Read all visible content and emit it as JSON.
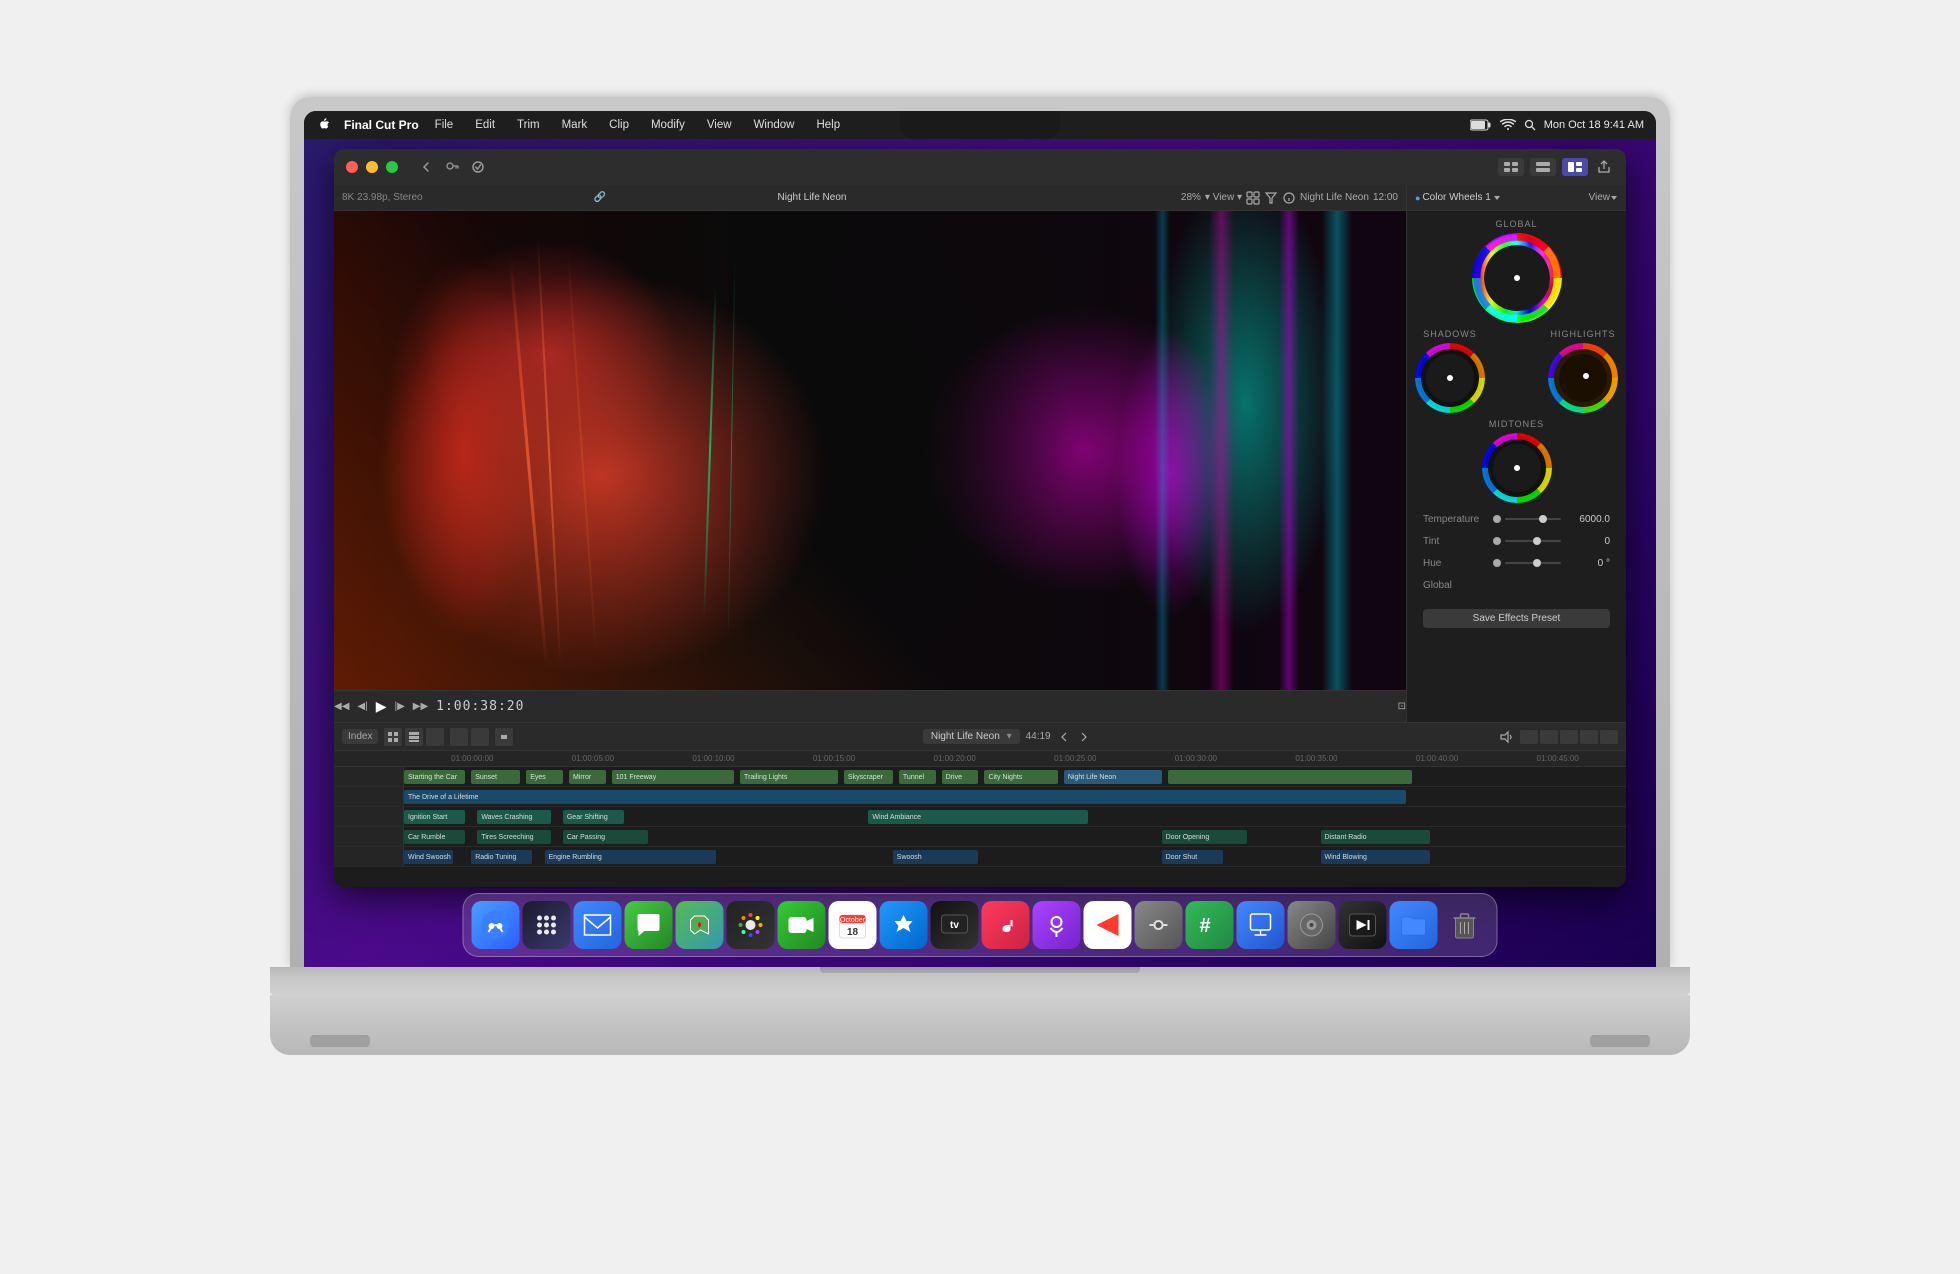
{
  "menubar": {
    "app": "Final Cut Pro",
    "items": [
      "File",
      "Edit",
      "Trim",
      "Mark",
      "Clip",
      "Modify",
      "View",
      "Window",
      "Help"
    ],
    "right": {
      "datetime": "Mon Oct 18  9:41 AM"
    }
  },
  "window": {
    "title": "Night Life Neon",
    "resolution": "8K 23.98p, Stereo",
    "zoom": "28%",
    "timecode": "1:00:38:20",
    "duration": "12:00"
  },
  "colorPanel": {
    "title": "Color Wheels 1",
    "view_btn": "View",
    "wheels": {
      "global_label": "GLOBAL",
      "shadows_label": "SHADOWS",
      "highlights_label": "HIGHLIGHTS",
      "midtones_label": "MIDTONES"
    },
    "params": [
      {
        "label": "Temperature",
        "value": "6000.0"
      },
      {
        "label": "Tint",
        "value": "0"
      },
      {
        "label": "Hue",
        "value": "0 °"
      },
      {
        "label": "Global",
        "value": ""
      }
    ],
    "save_btn": "Save Effects Preset"
  },
  "timeline": {
    "clip_name": "Night Life Neon",
    "timecode_display": "44:19",
    "ruler_marks": [
      "01:00:00:00",
      "01:00:05:00",
      "01:00:10:00",
      "01:00:15:00",
      "01:00:20:00",
      "01:00:25:00",
      "01:00:30:00",
      "01:00:35:00",
      "01:00:40:00",
      "01:00:45:00"
    ],
    "tracks": [
      {
        "clips": [
          {
            "label": "Starting the Car",
            "left": "0%",
            "width": "5%",
            "color": "#4a7a4a"
          },
          {
            "label": "Sunset",
            "left": "5.5%",
            "width": "4%",
            "color": "#4a7a4a"
          },
          {
            "label": "Eyes",
            "left": "10%",
            "width": "3%",
            "color": "#4a7a4a"
          },
          {
            "label": "Mirror",
            "left": "13.5%",
            "width": "3%",
            "color": "#4a7a4a"
          },
          {
            "label": "101 Freeway",
            "left": "17%",
            "width": "10%",
            "color": "#4a7a4a"
          },
          {
            "label": "Trailing Lights",
            "left": "27.5%",
            "width": "8%",
            "color": "#4a7a4a"
          },
          {
            "label": "Skyscraper",
            "left": "36%",
            "width": "4%",
            "color": "#4a7a4a"
          },
          {
            "label": "Tunnel",
            "left": "40.5%",
            "width": "3%",
            "color": "#4a7a4a"
          },
          {
            "label": "Drive",
            "left": "44%",
            "width": "3%",
            "color": "#4a7a4a"
          },
          {
            "label": "City Nights",
            "left": "47.5%",
            "width": "6%",
            "color": "#4a7a4a"
          },
          {
            "label": "Night Life Neon",
            "left": "54%",
            "width": "8%",
            "color": "#3a6a8a"
          },
          {
            "label": "",
            "left": "62.5%",
            "width": "20%",
            "color": "#4a7a4a"
          }
        ]
      },
      {
        "clips": [
          {
            "label": "The Drive of a Lifetime",
            "left": "0%",
            "width": "82%",
            "color": "#2a5a7a"
          }
        ]
      },
      {
        "clips": [
          {
            "label": "Ignition Start",
            "left": "0%",
            "width": "5%",
            "color": "#2a6a5a"
          },
          {
            "label": "Waves Crashing",
            "left": "6%",
            "width": "6%",
            "color": "#2a6a5a"
          },
          {
            "label": "Gear Shifting",
            "left": "13%",
            "width": "5%",
            "color": "#2a6a5a"
          },
          {
            "label": "Wind Ambiance",
            "left": "38%",
            "width": "18%",
            "color": "#2a6a5a"
          }
        ]
      },
      {
        "clips": [
          {
            "label": "Car Rumble",
            "left": "0%",
            "width": "5%",
            "color": "#2a5a4a"
          },
          {
            "label": "Tires Screeching",
            "left": "6%",
            "width": "6%",
            "color": "#2a5a4a"
          },
          {
            "label": "Car Passing",
            "left": "13%",
            "width": "7%",
            "color": "#2a5a4a"
          },
          {
            "label": "Door Opening",
            "left": "62%",
            "width": "7%",
            "color": "#2a5a4a"
          },
          {
            "label": "Distant Radio",
            "left": "75%",
            "width": "9%",
            "color": "#2a5a4a"
          }
        ]
      },
      {
        "clips": [
          {
            "label": "Wind Swoosh",
            "left": "0%",
            "width": "4%",
            "color": "#2a4a6a"
          },
          {
            "label": "Radio Tuning",
            "left": "5.5%",
            "width": "5%",
            "color": "#2a4a6a"
          },
          {
            "label": "Engine Rumbling",
            "left": "11.5%",
            "width": "14%",
            "color": "#2a4a6a"
          },
          {
            "label": "Swoosh",
            "left": "40%",
            "width": "7%",
            "color": "#2a4a6a"
          },
          {
            "label": "Door Shut",
            "left": "62%",
            "width": "5%",
            "color": "#2a4a6a"
          },
          {
            "label": "Wind Blowing",
            "left": "75%",
            "width": "9%",
            "color": "#2a4a6a"
          }
        ]
      }
    ]
  },
  "dock": {
    "icons": [
      "🔍",
      "📱",
      "🗒️",
      "✉️",
      "🗺️",
      "📸",
      "🎵",
      "📅",
      "🛒",
      "📺",
      "🎵",
      "🎙️",
      "📰",
      "📡",
      "📊",
      "📝",
      "🛍️",
      "⚙️",
      "🎬",
      "📁",
      "🗑️"
    ]
  }
}
